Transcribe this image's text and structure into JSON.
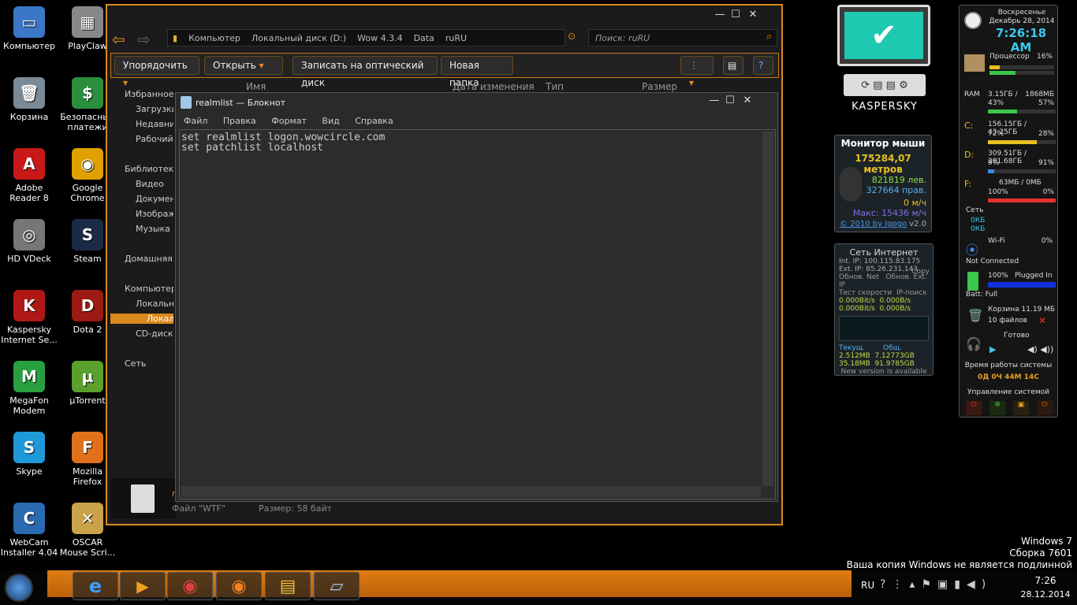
{
  "desktop_icons": [
    {
      "label": "Компьютер",
      "glyph": "▭",
      "color": "#3a78c7"
    },
    {
      "label": "PlayClaw",
      "glyph": "▦",
      "color": "#888"
    },
    {
      "label": "Корзина",
      "glyph": "🗑",
      "color": "#7a8a96"
    },
    {
      "label": "Безопасные платежи",
      "glyph": "$",
      "color": "#2a8f3c"
    },
    {
      "label": "Adobe Reader 8",
      "glyph": "A",
      "color": "#c81818"
    },
    {
      "label": "Google Chrome",
      "glyph": "◉",
      "color": "#e0a000"
    },
    {
      "label": "HD VDeck",
      "glyph": "◎",
      "color": "#777"
    },
    {
      "label": "Steam",
      "glyph": "S",
      "color": "#1b2a48"
    },
    {
      "label": "Kaspersky Internet Se...",
      "glyph": "K",
      "color": "#b01818"
    },
    {
      "label": "Dota 2",
      "glyph": "D",
      "color": "#9c1a14"
    },
    {
      "label": "MegaFon Modem",
      "glyph": "M",
      "color": "#28a040"
    },
    {
      "label": "µTorrent",
      "glyph": "µ",
      "color": "#5aa02c"
    },
    {
      "label": "Skype",
      "glyph": "S",
      "color": "#1f9ad8"
    },
    {
      "label": "Mozilla Firefox",
      "glyph": "F",
      "color": "#e0701a"
    },
    {
      "label": "WebCam Installer 4.04",
      "glyph": "C",
      "color": "#2a6ab0"
    },
    {
      "label": "OSCAR Mouse Scri...",
      "glyph": "✕",
      "color": "#c9a24a"
    }
  ],
  "explorer": {
    "breadcrumb": [
      "Компьютер",
      "Локальный диск (D:)",
      "Wow 4.3.4",
      "Data",
      "ruRU"
    ],
    "search_placeholder": "Поиск: ruRU",
    "toolbar": {
      "organize": "Упорядочить",
      "open": "Открыть",
      "burn": "Записать на оптический диск",
      "new_folder": "Новая папка"
    },
    "nav": [
      "Избранное",
      "Загрузки",
      "Недавние места",
      "Рабочий стол",
      "Библиотеки",
      "Видео",
      "Документы",
      "Изображения",
      "Музыка",
      "Домашняя группа",
      "Компьютер",
      "Локальный диск (C:)",
      "Локальный диск (D:)",
      "CD-дисковод",
      "Сеть"
    ],
    "columns": [
      "Имя",
      "Дата изменения",
      "Тип",
      "Размер"
    ],
    "detail": {
      "name": "r",
      "type": "Файл \"WTF\"",
      "size": "Размер: 58 байт"
    }
  },
  "notepad": {
    "title": "realmlist — Блокнот",
    "menu": [
      "Файл",
      "Правка",
      "Формат",
      "Вид",
      "Справка"
    ],
    "lines": [
      "set realmlist logon.wowcircle.com",
      "set patchlist localhost"
    ]
  },
  "kaspersky": {
    "brand": "KASPERSKY"
  },
  "mouse_monitor": {
    "title": "Монитор мыши",
    "distance": "175284,07 метров",
    "left": "821819 лев.",
    "right": "327664 прав.",
    "speed": "0 м/ч",
    "max": "Макс: 15436 м/ч",
    "credit": "© 2010 by Igogo",
    "version": "v2.0"
  },
  "net_gadget": {
    "title": "Сеть Интернет",
    "int_ip": "Int. IP: 100.115.83.175",
    "ext_ip": "Ext. IP: 85.26.231.143",
    "copy": "Copy",
    "refresh": "Обнов. Net",
    "refresh_ext": "Обнов. Ext. IP",
    "speed_test": "Тест скорости",
    "ip_search": "IP-поиск",
    "up1": "0.000Bit/s",
    "up2": "0.000B/s",
    "down1": "0.000Bit/s",
    "down2": "0.000B/s",
    "current_label": "Текущ.",
    "total_label": "Общ.",
    "cur_up": "2.512MB",
    "cur_down": "35.18MB",
    "tot_up": "7.12773GB",
    "tot_down": "91.9785GB",
    "update": "New version is available"
  },
  "sysmon": {
    "day": "Воскресенье",
    "date": "Декабрь 28, 2014",
    "time": "7:26:18 AM",
    "cpu_label": "Процессор",
    "cpu": "16%",
    "cpu_pct": 16,
    "ram_label": "RAM",
    "ram_used": "3.15ГБ /",
    "ram_total": "1868МБ",
    "ram_pct_text": "43%",
    "ram_pct2": "57%",
    "ram_pct": 43,
    "c_label": "C:",
    "c_size": "156.15ГБ / 43.25ГБ",
    "c_pct1": "72%",
    "c_pct2": "28%",
    "c_pct": 72,
    "d_label": "D:",
    "d_size": "309.51ГБ / 281.68ГБ",
    "d_pct1": "9%",
    "d_pct2": "91%",
    "d_pct": 9,
    "f_label": "F:",
    "f_size": "63МБ / 0МБ",
    "f_pct1": "100%",
    "f_pct2": "0%",
    "f_pct": 100,
    "net_label": "Сеть",
    "net_up": "0КБ",
    "net_down": "0КБ",
    "wifi_label": "Wi-Fi",
    "wifi_pct": "0%",
    "wifi_status": "Not Connected",
    "batt_pct": "100%",
    "batt_state": "Plugged In",
    "batt_label": "Batt: Full",
    "bin_label": "Корзина 11.19 МБ",
    "bin_files": "10 файлов",
    "media": "Готово",
    "uptime_label": "Время работы системы",
    "uptime": "0Д 0Ч 44М 14С",
    "control_label": "Управление системой"
  },
  "watermark": {
    "line1": "Windows 7",
    "line2": "Сборка 7601",
    "line3": "Ваша копия Windows не является подлинной"
  },
  "tray": {
    "lang": "RU",
    "time": "7:26",
    "date": "28.12.2014"
  }
}
